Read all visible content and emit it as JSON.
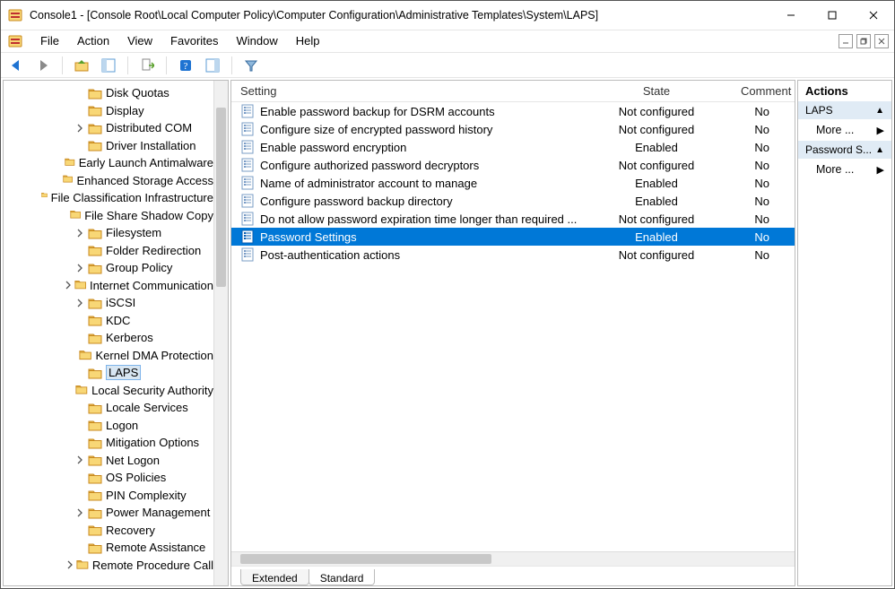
{
  "window": {
    "title": "Console1 - [Console Root\\Local Computer Policy\\Computer Configuration\\Administrative Templates\\System\\LAPS]"
  },
  "menu": {
    "items": [
      "File",
      "Action",
      "View",
      "Favorites",
      "Window",
      "Help"
    ]
  },
  "tree": {
    "items": [
      {
        "indent": 5,
        "exp": "",
        "label": "Disk Quotas"
      },
      {
        "indent": 5,
        "exp": "",
        "label": "Display"
      },
      {
        "indent": 5,
        "exp": ">",
        "label": "Distributed COM"
      },
      {
        "indent": 5,
        "exp": "",
        "label": "Driver Installation"
      },
      {
        "indent": 5,
        "exp": "",
        "label": "Early Launch Antimalware"
      },
      {
        "indent": 5,
        "exp": "",
        "label": "Enhanced Storage Access"
      },
      {
        "indent": 5,
        "exp": "",
        "label": "File Classification Infrastructure"
      },
      {
        "indent": 5,
        "exp": "",
        "label": "File Share Shadow Copy"
      },
      {
        "indent": 5,
        "exp": ">",
        "label": "Filesystem"
      },
      {
        "indent": 5,
        "exp": "",
        "label": "Folder Redirection"
      },
      {
        "indent": 5,
        "exp": ">",
        "label": "Group Policy"
      },
      {
        "indent": 5,
        "exp": ">",
        "label": "Internet Communication"
      },
      {
        "indent": 5,
        "exp": ">",
        "label": "iSCSI"
      },
      {
        "indent": 5,
        "exp": "",
        "label": "KDC"
      },
      {
        "indent": 5,
        "exp": "",
        "label": "Kerberos"
      },
      {
        "indent": 5,
        "exp": "",
        "label": "Kernel DMA Protection"
      },
      {
        "indent": 5,
        "exp": "",
        "label": "LAPS",
        "selected": true
      },
      {
        "indent": 5,
        "exp": "",
        "label": "Local Security Authority"
      },
      {
        "indent": 5,
        "exp": "",
        "label": "Locale Services"
      },
      {
        "indent": 5,
        "exp": "",
        "label": "Logon"
      },
      {
        "indent": 5,
        "exp": "",
        "label": "Mitigation Options"
      },
      {
        "indent": 5,
        "exp": ">",
        "label": "Net Logon"
      },
      {
        "indent": 5,
        "exp": "",
        "label": "OS Policies"
      },
      {
        "indent": 5,
        "exp": "",
        "label": "PIN Complexity"
      },
      {
        "indent": 5,
        "exp": ">",
        "label": "Power Management"
      },
      {
        "indent": 5,
        "exp": "",
        "label": "Recovery"
      },
      {
        "indent": 5,
        "exp": "",
        "label": "Remote Assistance"
      },
      {
        "indent": 5,
        "exp": ">",
        "label": "Remote Procedure Call"
      }
    ]
  },
  "list": {
    "columns": {
      "setting": "Setting",
      "state": "State",
      "comment": "Comment"
    },
    "rows": [
      {
        "setting": "Enable password backup for DSRM accounts",
        "state": "Not configured",
        "comment": "No"
      },
      {
        "setting": "Configure size of encrypted password history",
        "state": "Not configured",
        "comment": "No"
      },
      {
        "setting": "Enable password encryption",
        "state": "Enabled",
        "comment": "No"
      },
      {
        "setting": "Configure authorized password decryptors",
        "state": "Not configured",
        "comment": "No"
      },
      {
        "setting": "Name of administrator account to manage",
        "state": "Enabled",
        "comment": "No"
      },
      {
        "setting": "Configure password backup directory",
        "state": "Enabled",
        "comment": "No"
      },
      {
        "setting": "Do not allow password expiration time longer than required ...",
        "state": "Not configured",
        "comment": "No"
      },
      {
        "setting": "Password Settings",
        "state": "Enabled",
        "comment": "No",
        "selected": true
      },
      {
        "setting": "Post-authentication actions",
        "state": "Not configured",
        "comment": "No"
      }
    ]
  },
  "tabs": {
    "extended": "Extended",
    "standard": "Standard"
  },
  "actions": {
    "title": "Actions",
    "sections": [
      {
        "header": "LAPS",
        "items": [
          "More ..."
        ]
      },
      {
        "header": "Password S...",
        "items": [
          "More ..."
        ]
      }
    ]
  }
}
